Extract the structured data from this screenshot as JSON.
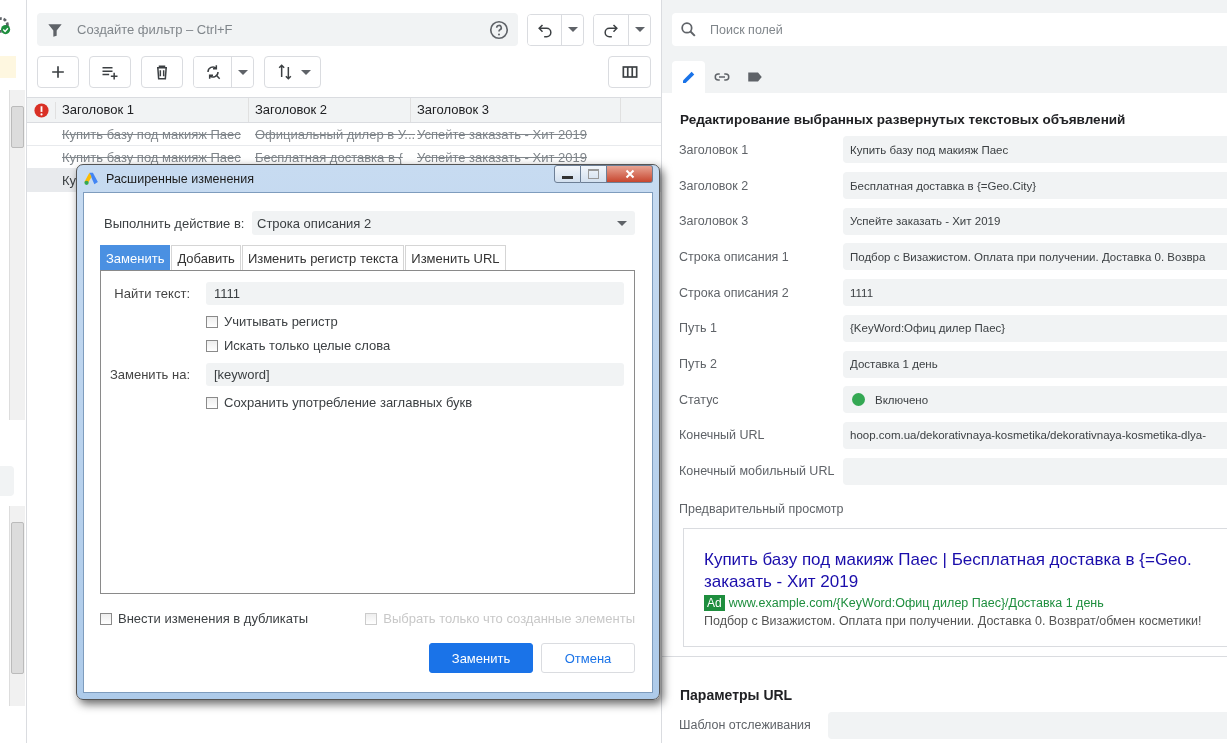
{
  "filter": {
    "placeholder": "Создайте фильтр – Ctrl+F"
  },
  "table": {
    "columns": [
      "Заголовок 1",
      "Заголовок 2",
      "Заголовок 3"
    ],
    "rows": [
      {
        "cells": [
          "Купить базу под макияж Паес",
          "Официальный дилер в У...",
          "Успейте заказать - Хит 2019"
        ],
        "deleted": true,
        "selected": false
      },
      {
        "cells": [
          "Купить базу под макияж Паес",
          "Бесплатная доставка в {",
          "Успейте заказать - Хит 2019"
        ],
        "deleted": true,
        "selected": false
      },
      {
        "cells": [
          "Ку"
        ],
        "deleted": false,
        "selected": true
      }
    ]
  },
  "field_search": {
    "placeholder": "Поиск полей"
  },
  "editor_tabs": [
    {
      "kind": "edit",
      "selected": true
    },
    {
      "kind": "link",
      "selected": false
    },
    {
      "kind": "label",
      "selected": false
    }
  ],
  "section_title": "Редактирование выбранных развернутых текстовых объявлений",
  "fields": [
    {
      "label": "Заголовок 1",
      "value": "Купить базу под макияж Паес",
      "kind": "text"
    },
    {
      "label": "Заголовок 2",
      "value": "Бесплатная доставка в {=Geo.City}",
      "kind": "text"
    },
    {
      "label": "Заголовок 3",
      "value": "Успейте заказать - Хит 2019",
      "kind": "text"
    },
    {
      "label": "Строка описания 1",
      "value": "Подбор с Визажистом. Оплата при получении. Доставка 0. Возвра",
      "kind": "text"
    },
    {
      "label": "Строка описания 2",
      "value": "1111",
      "kind": "text"
    },
    {
      "label": "Путь 1",
      "value": "{KeyWord:Офиц дилер Паес}",
      "kind": "text"
    },
    {
      "label": "Путь 2",
      "value": "Доставка 1 день",
      "kind": "text"
    },
    {
      "label": "Статус",
      "value": "Включено",
      "kind": "status"
    },
    {
      "label": "Конечный URL",
      "value": "hoop.com.ua/dekorativnaya-kosmetika/dekorativnaya-kosmetika-dlya-",
      "kind": "text"
    },
    {
      "label": "Конечный мобильный URL",
      "kind": "text"
    }
  ],
  "preview": {
    "label": "Предварительный просмотр",
    "title_lines": [
      "Купить базу под макияж Паес | Бесплатная доставка в {=Geo.",
      "заказать - Хит 2019"
    ],
    "badge": "Ad",
    "url": "www.example.com/{KeyWord:Офиц дилер Паес}/Доставка 1 день",
    "description": "Подбор с Визажистом. Оплата при получении. Доставка 0. Возврат/обмен косметики!"
  },
  "url_params": {
    "title": "Параметры URL",
    "fields": [
      {
        "label": "Шаблон отслеживания"
      }
    ]
  },
  "dialog": {
    "title": "Расширенные изменения",
    "target_label": "Выполнить действие в:",
    "target_value": "Строка описания 2",
    "tabs": [
      {
        "label": "Заменить",
        "selected": true
      },
      {
        "label": "Добавить",
        "selected": false
      },
      {
        "label": "Изменить регистр текста",
        "selected": false
      },
      {
        "label": "Изменить URL",
        "selected": false
      }
    ],
    "find_label": "Найти текст:",
    "find_value": "1111",
    "find_options": [
      {
        "label": "Учитывать регистр",
        "checked": false
      },
      {
        "label": "Искать только целые слова",
        "checked": false
      }
    ],
    "replace_label": "Заменить на:",
    "replace_value": "[keyword]",
    "replace_options": [
      {
        "label": "Сохранить употребление заглавных букв",
        "checked": false
      }
    ],
    "footer_options": [
      {
        "label": "Внести изменения в дубликаты",
        "checked": false,
        "disabled": false
      },
      {
        "label": "Выбрать только что созданные элементы",
        "checked": false,
        "disabled": true
      }
    ],
    "buttons": [
      {
        "label": "Заменить",
        "kind": "primary"
      },
      {
        "label": "Отмена",
        "kind": "secondary"
      }
    ]
  }
}
